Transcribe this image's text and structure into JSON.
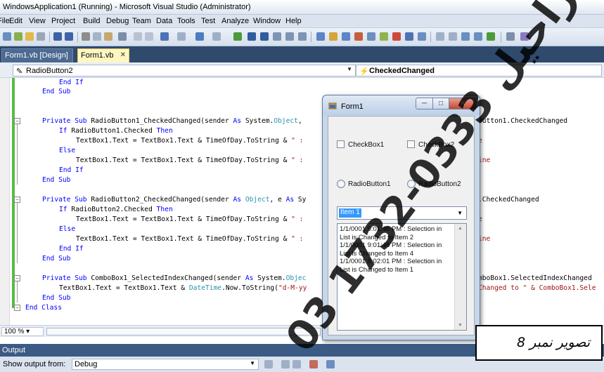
{
  "window": {
    "title": "WindowsApplication1 (Running) - Microsoft Visual Studio (Administrator)"
  },
  "menu": [
    "File",
    "Edit",
    "View",
    "Project",
    "Build",
    "Debug",
    "Team",
    "Data",
    "Tools",
    "Test",
    "Analyze",
    "Window",
    "Help"
  ],
  "tabs": {
    "design": "Form1.vb [Design]",
    "code": "Form1.vb",
    "close_glyph": "✕"
  },
  "navbar": {
    "object": "RadioButton2",
    "event": "CheckedChanged"
  },
  "code": {
    "l1": "End If",
    "l2": "End Sub",
    "l3a": "Private Sub ",
    "l3b": "RadioButton1_CheckedChanged(sender ",
    "l3c": "As ",
    "l3d": "System.",
    "l3e": "Object",
    "l3f": ", ",
    "l3tail": "Button1.CheckedChanged",
    "l4": "If ",
    "l4b": "RadioButton1.Checked ",
    "l4c": "Then",
    "l5a": "TextBox1.Text = TextBox1.Text & TimeOfDay.ToString & ",
    "l5b": "\" :",
    "l5tail": "e",
    "l6": "Else",
    "l7a": "TextBox1.Text = TextBox1.Text & TimeOfDay.ToString & ",
    "l7b": "\" :",
    "l7tail": "ine",
    "l8": "End If",
    "l9": "End Sub",
    "m3a": "Private Sub ",
    "m3b": "RadioButton2_CheckedChanged(sender ",
    "m3c": "As ",
    "m3d": "Object",
    "m3e": ", e ",
    "m3f": "As ",
    "m3g": "Sy",
    "m3tail": ".CheckedChanged",
    "m4": "If ",
    "m4b": "RadioButton2.Checked ",
    "m4c": "Then",
    "m5a": "TextBox1.Text = TextBox1.Text & TimeOfDay.ToString & ",
    "m5b": "\" :",
    "m5tail": "e",
    "m6": "Else",
    "m7a": "TextBox1.Text = TextBox1.Text & TimeOfDay.ToString & ",
    "m7b": "\" :",
    "m7tail": "ine",
    "m8": "End If",
    "m9": "End Sub",
    "n1a": "Private Sub ",
    "n1b": "ComboBox1_SelectedIndexChanged(sender ",
    "n1c": "As ",
    "n1d": "System.",
    "n1e": "Objec",
    "n1tail": "mboBox1.SelectedIndexChanged",
    "n2a": "TextBox1.Text = TextBox1.Text & ",
    "n2b": "DateTime",
    "n2c": ".Now.ToString(",
    "n2d": "\"d-M-yy",
    "n2tail": "Changed to \" & ComboBox1.Sele",
    "n3": "End Sub",
    "n4": "End Class"
  },
  "editor_footer": {
    "zoom": "100 %"
  },
  "output": {
    "title": "Output",
    "show_label": "Show output from:",
    "source": "Debug"
  },
  "form": {
    "title": "Form1",
    "checkbox1": "CheckBox1",
    "checkbox2": "CheckBox2",
    "radio1": "RadioButton1",
    "radio2": "RadioButton2",
    "combo_value": "Item 1",
    "textbox": "1/1/0001 9:01:46 PM : Selection in List is Changed to Item 2\n1/1/0001 9:01:48 PM : Selection in List is Changed to Item 4\n1/1/0001 9:02:01 PM : Selection in List is Changed to Item 1"
  },
  "watermark": {
    "text": "طارق راحیل 0333-1732 03",
    "color": "#000000"
  },
  "caption": {
    "text": "تصویر نمبر 8"
  },
  "colors": {
    "keyword": "#0000ff",
    "type": "#2b91af",
    "string": "#a31515",
    "active_tab": "#fff7c2"
  }
}
